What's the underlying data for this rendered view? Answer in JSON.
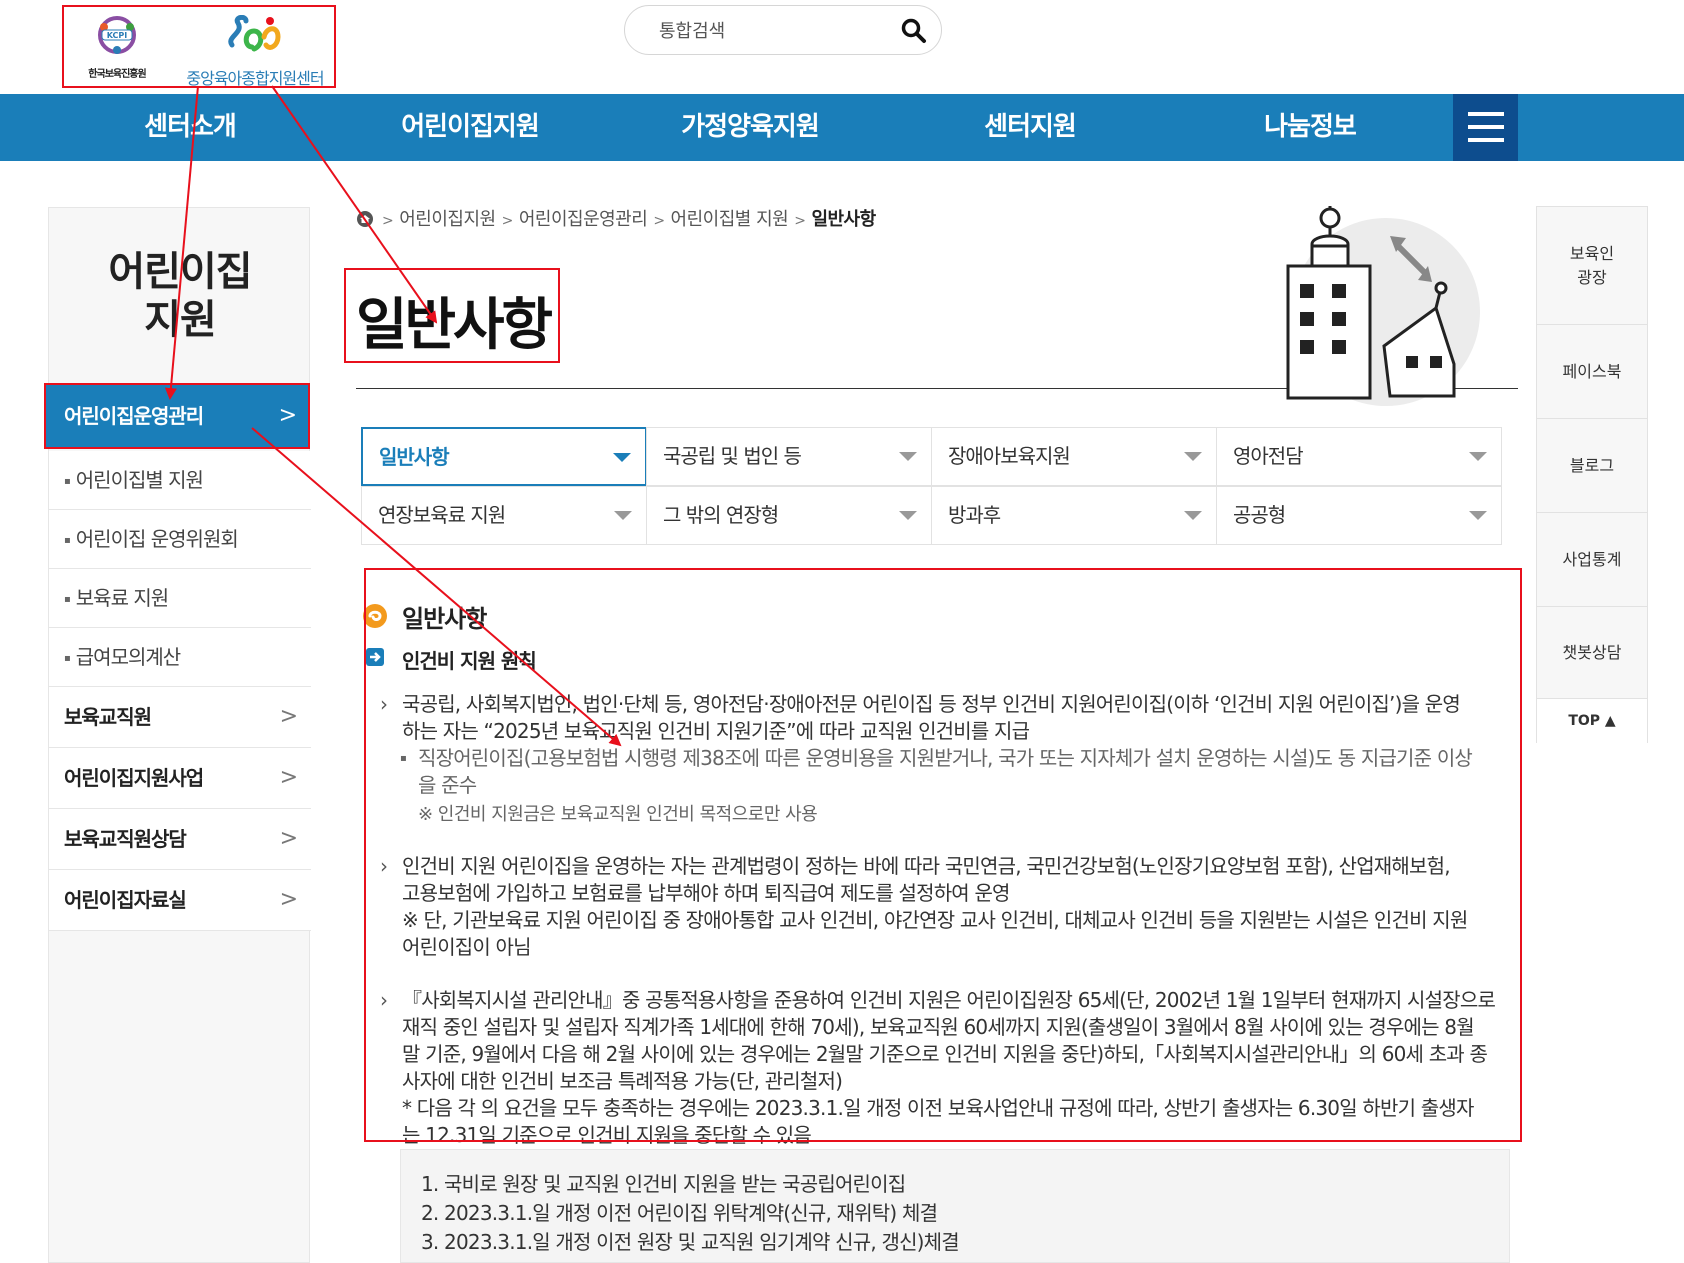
{
  "header": {
    "logo_kcpi_badge": "KCPI",
    "logo_kcpi_name": "한국보육진흥원",
    "logo_center_name": "중앙육아종합지원센터",
    "search_placeholder": "통합검색"
  },
  "gnb": {
    "items": [
      "센터소개",
      "어린이집지원",
      "가정양육지원",
      "센터지원",
      "나눔정보"
    ]
  },
  "lnb": {
    "title_line1": "어린이집",
    "title_line2": "지원",
    "active": "어린이집운영관리",
    "sub_items": [
      "어린이집별 지원",
      "어린이집 운영위원회",
      "보육료 지원",
      "급여모의계산"
    ],
    "main_items": [
      "보육교직원",
      "어린이집지원사업",
      "보육교직원상담",
      "어린이집자료실"
    ]
  },
  "breadcrumb": {
    "items": [
      "어린이집지원",
      "어린이집운영관리",
      "어린이집별 지원"
    ],
    "current": "일반사항"
  },
  "page_title": "일반사항",
  "quick": {
    "items": [
      {
        "line1": "보육인",
        "line2": "광장"
      },
      {
        "line1": "페이스북",
        "line2": ""
      },
      {
        "line1": "블로그",
        "line2": ""
      },
      {
        "line1": "사업통계",
        "line2": ""
      },
      {
        "line1": "챗봇상담",
        "line2": ""
      }
    ],
    "top": "TOP ▲"
  },
  "tabs": [
    "일반사항",
    "국공립 및 법인 등",
    "장애아보육지원",
    "영아전담",
    "연장보육료 지원",
    "그 밖의 연장형",
    "방과후",
    "공공형"
  ],
  "content": {
    "heading": "일반사항",
    "subheading": "인건비 지원 원칙",
    "p1_line1": "국공립, 사회복지법인, 법인·단체 등, 영아전담·장애아전문 어린이집 등 정부 인건비 지원어린이집(이하 ‘인건비 지원 어린이집’)을 운영",
    "p1_line2": "하는 자는 “2025년 보육교직원 인건비 지원기준”에 따라 교직원 인건비를 지급",
    "p1_sub_line1": "직장어린이집(고용보험법 시행령 제38조에 따른 운영비용을 지원받거나, 국가 또는 지자체가 설치 운영하는 시설)도 동 지급기준 이상",
    "p1_sub_line2": "을 준수",
    "p1_note": "※ 인건비 지원금은 보육교직원 인건비 목적으로만 사용",
    "p2_line1": "인건비 지원 어린이집을 운영하는 자는 관계법령이 정하는 바에 따라 국민연금, 국민건강보험(노인장기요양보험 포함), 산업재해보험,",
    "p2_line2": "고용보험에 가입하고 보험료를 납부해야 하며 퇴직급여 제도를 설정하여 운영",
    "p2_line3": "※ 단, 기관보육료 지원 어린이집 중 장애아통합 교사 인건비, 야간연장 교사 인건비, 대체교사 인건비 등을 지원받는 시설은 인건비 지원",
    "p2_line4": "어린이집이 아님",
    "p3_line1": "『사회복지시설 관리안내』중 공통적용사항을 준용하여 인건비 지원은 어린이집원장 65세(단, 2002년 1월 1일부터 현재까지 시설장으로",
    "p3_line2": "재직 중인 설립자 및 설립자 직계가족 1세대에 한해 70세), 보육교직원 60세까지 지원(출생일이 3월에서 8월 사이에 있는 경우에는 8월",
    "p3_line3": "말 기준, 9월에서 다음 해 2월 사이에 있는 경우에는 2월말 기준으로 인건비 지원을 중단)하되,「사회복지시설관리안내」의 60세 초과 종",
    "p3_line4": "사자에 대한 인건비 보조금 특례적용 가능(단, 관리철저)",
    "p3_line5": "* 다음 각 의 요건을 모두 충족하는 경우에는 2023.3.1.일 개정 이전 보육사업안내 규정에 따라, 상반기 출생자는 6.30일 하반기 출생자",
    "p3_line6": "는 12.31일 기준으로 인건비 지원을 중단할 수 있음",
    "list": [
      "1. 국비로 원장 및 교직원 인건비 지원을 받는 국공립어린이집",
      "2. 2023.3.1.일 개정 이전 어린이집 위탁계약(신규, 재위탁) 체결",
      "3. 2023.3.1.일 개정 이전 원장 및 교직원 임기계약 신규, 갱신)체결"
    ]
  },
  "colors": {
    "brand_blue": "#1a7eb9",
    "menu_dark": "#0d4d8e",
    "annotation_red": "#e8101c"
  }
}
